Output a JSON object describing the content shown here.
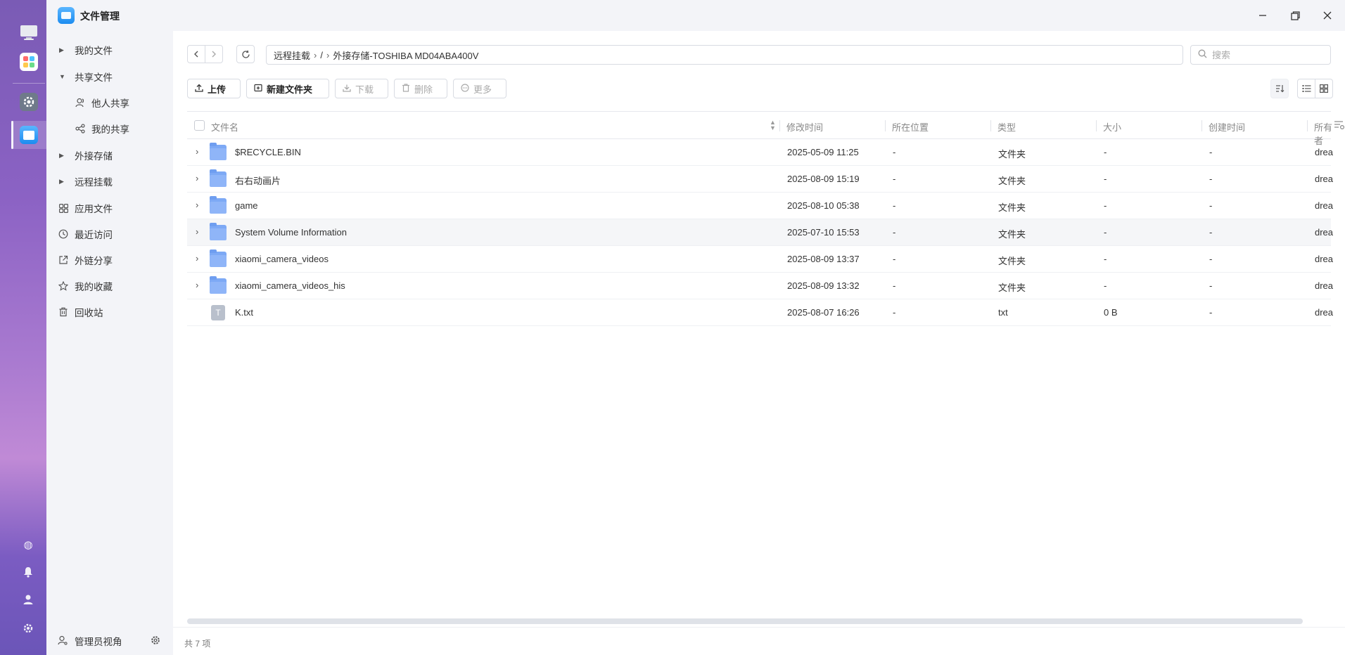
{
  "window": {
    "title": "文件管理",
    "minimize_icon": "minimize-icon",
    "maximize_icon": "restore-icon",
    "close_icon": "close-icon"
  },
  "launcher": {
    "apps": [
      {
        "name": "desktop-monitor-icon"
      },
      {
        "name": "app-center-icon"
      },
      {
        "name": "settings-app-icon"
      },
      {
        "name": "file-manager-app-icon"
      }
    ],
    "system": [
      "support-icon",
      "notification-bell-icon",
      "user-icon",
      "system-settings-icon"
    ]
  },
  "sidebar": {
    "items": [
      {
        "label": "我的文件",
        "type": "group",
        "expanded": false
      },
      {
        "label": "共享文件",
        "type": "group",
        "expanded": true
      },
      {
        "label": "他人共享",
        "type": "sub",
        "icon": "users-icon"
      },
      {
        "label": "我的共享",
        "type": "sub",
        "icon": "share-icon"
      },
      {
        "label": "外接存储",
        "type": "group",
        "expanded": false
      },
      {
        "label": "远程挂载",
        "type": "group",
        "expanded": false
      },
      {
        "label": "应用文件",
        "type": "item",
        "icon": "apps-grid-icon"
      },
      {
        "label": "最近访问",
        "type": "item",
        "icon": "clock-icon"
      },
      {
        "label": "外链分享",
        "type": "item",
        "icon": "external-link-icon"
      },
      {
        "label": "我的收藏",
        "type": "item",
        "icon": "star-icon"
      },
      {
        "label": "回收站",
        "type": "item",
        "icon": "trash-icon"
      }
    ],
    "admin_label": "管理员视角"
  },
  "toolbar": {
    "path": [
      "远程挂载",
      "/",
      "外接存储-TOSHIBA MD04ABA400V"
    ],
    "search_placeholder": "搜索",
    "buttons": [
      {
        "label": "上传",
        "enabled": true,
        "icon": "upload-icon"
      },
      {
        "label": "新建文件夹",
        "enabled": true,
        "icon": "new-folder-icon"
      },
      {
        "label": "下载",
        "enabled": false,
        "icon": "download-icon"
      },
      {
        "label": "删除",
        "enabled": false,
        "icon": "delete-icon"
      },
      {
        "label": "更多",
        "enabled": false,
        "icon": "more-icon"
      }
    ]
  },
  "table": {
    "columns": [
      "文件名",
      "修改时间",
      "所在位置",
      "类型",
      "大小",
      "创建时间",
      "所有者"
    ],
    "rows": [
      {
        "name": "$RECYCLE.BIN",
        "modified": "2025-05-09 11:25",
        "location": "-",
        "type": "文件夹",
        "size": "-",
        "created": "-",
        "owner": "dream",
        "kind": "folder"
      },
      {
        "name": "右右动画片",
        "modified": "2025-08-09 15:19",
        "location": "-",
        "type": "文件夹",
        "size": "-",
        "created": "-",
        "owner": "dream",
        "kind": "folder"
      },
      {
        "name": "game",
        "modified": "2025-08-10 05:38",
        "location": "-",
        "type": "文件夹",
        "size": "-",
        "created": "-",
        "owner": "dream",
        "kind": "folder"
      },
      {
        "name": "System Volume Information",
        "modified": "2025-07-10 15:53",
        "location": "-",
        "type": "文件夹",
        "size": "-",
        "created": "-",
        "owner": "dream",
        "kind": "folder"
      },
      {
        "name": "xiaomi_camera_videos",
        "modified": "2025-08-09 13:37",
        "location": "-",
        "type": "文件夹",
        "size": "-",
        "created": "-",
        "owner": "dream",
        "kind": "folder"
      },
      {
        "name": "xiaomi_camera_videos_his",
        "modified": "2025-08-09 13:32",
        "location": "-",
        "type": "文件夹",
        "size": "-",
        "created": "-",
        "owner": "dream",
        "kind": "folder"
      },
      {
        "name": "K.txt",
        "modified": "2025-08-07 16:26",
        "location": "-",
        "type": "txt",
        "size": "0 B",
        "created": "-",
        "owner": "dream",
        "kind": "txt"
      }
    ]
  },
  "status": {
    "count_text": "共 7 项"
  }
}
